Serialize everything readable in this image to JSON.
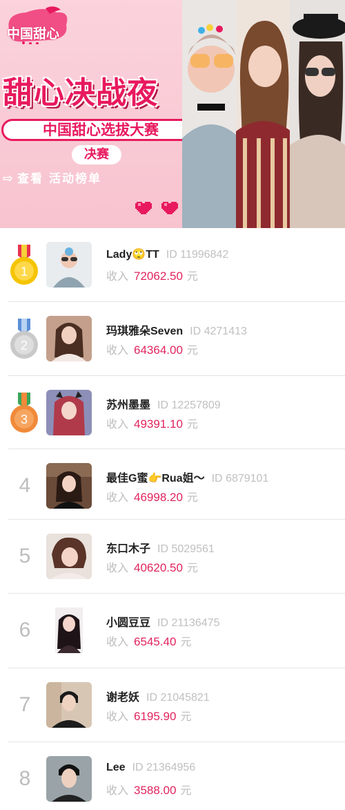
{
  "banner": {
    "logo_text": "中国甜心",
    "title": "甜心决战夜",
    "subtitle": "中国甜心选拔大赛",
    "final_label": "决赛",
    "view_link": "查看  活动榜单",
    "colors": {
      "accent": "#e8195e",
      "background": "#fbd3dc"
    }
  },
  "ranking": {
    "income_label": "收入",
    "currency_unit": "元",
    "id_prefix": "ID",
    "entries": [
      {
        "rank": "1",
        "name": "Lady🙄TT",
        "id": "11996842",
        "income": "72062.50",
        "medal": "gold"
      },
      {
        "rank": "2",
        "name": "玛琪雅朵Seven",
        "id": "4271413",
        "income": "64364.00",
        "medal": "silver"
      },
      {
        "rank": "3",
        "name": "苏州墨墨",
        "id": "12257809",
        "income": "49391.10",
        "medal": "bronze"
      },
      {
        "rank": "4",
        "name": "最佳G蜜👉Rua姐～",
        "id": "6879101",
        "income": "46998.20"
      },
      {
        "rank": "5",
        "name": "东口木子",
        "id": "5029561",
        "income": "40620.50"
      },
      {
        "rank": "6",
        "name": "小圆豆豆",
        "id": "21136475",
        "income": "6545.40"
      },
      {
        "rank": "7",
        "name": "谢老妖",
        "id": "21045821",
        "income": "6195.90"
      },
      {
        "rank": "8",
        "name": "Lee",
        "id": "21364956",
        "income": "3588.00"
      }
    ]
  }
}
